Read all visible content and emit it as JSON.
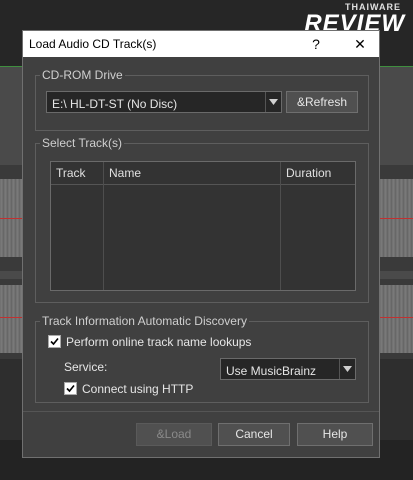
{
  "watermark": {
    "line1": "THAIWARE",
    "line2": "REVIEW"
  },
  "dialog": {
    "title": "Load Audio CD Track(s)",
    "help_glyph": "?",
    "close_glyph": "✕"
  },
  "cdrom": {
    "group_label": "CD-ROM Drive",
    "drive_value": "E:\\ HL-DT-ST (No Disc)",
    "refresh_label": "&Refresh"
  },
  "tracks": {
    "group_label": "Select Track(s)",
    "columns": [
      "Track",
      "Name",
      "Duration"
    ]
  },
  "discovery": {
    "group_label": "Track Information Automatic Discovery",
    "online_lookup_label": "Perform online track name lookups",
    "online_lookup_checked": true,
    "service_label": "Service:",
    "service_value": "Use MusicBrainz",
    "http_label": "Connect using HTTP",
    "http_checked": true
  },
  "footer": {
    "load_label": "&Load",
    "cancel_label": "Cancel",
    "help_label": "Help"
  }
}
